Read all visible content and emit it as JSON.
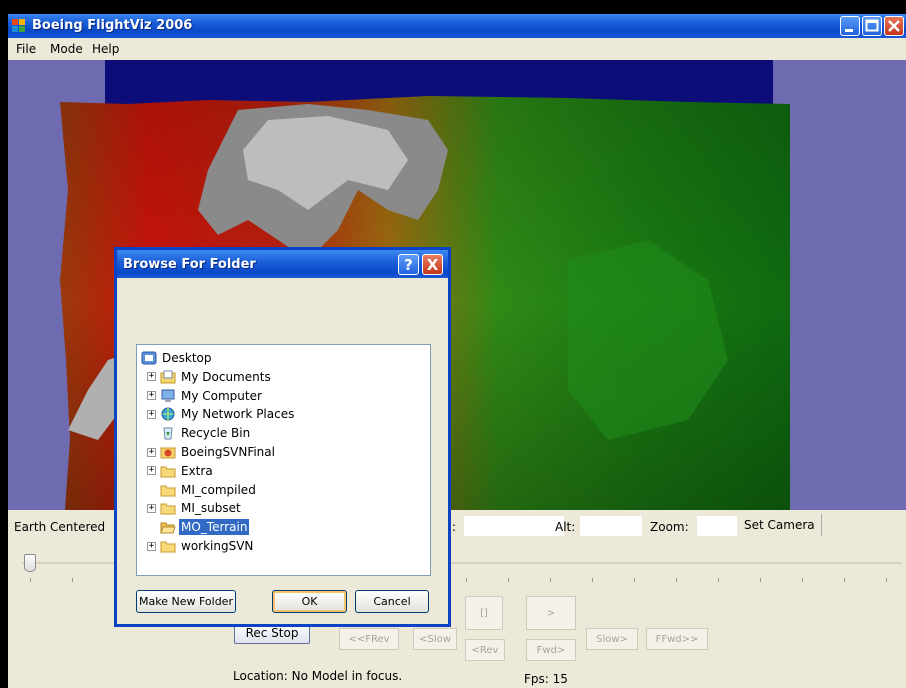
{
  "window": {
    "title": "Boeing FlightViz 2006",
    "icons": {
      "app": "app-icon",
      "minimize": "minimize-icon",
      "maximize": "maximize-icon",
      "close": "close-icon"
    }
  },
  "menu": {
    "items": [
      "File",
      "Mode",
      "Help"
    ]
  },
  "controls": {
    "camera_mode": "Earth Centered",
    "alt_label": "Alt:",
    "zoom_label": "Zoom:",
    "partial_label": ":",
    "set_camera": "Set Camera",
    "alt_value": "",
    "zoom_value": "",
    "rec_stop": "Rec Stop",
    "playback": {
      "stop": "[]",
      "play": ">",
      "ff_rev": "<<FRev",
      "slow_rev": "<Slow",
      "rev": "<Rev",
      "fwd": "Fwd>",
      "slow_fwd": "Slow>",
      "ff_fwd": "FFwd>>"
    },
    "location": "Location: No Model in focus.",
    "fps": "Fps: 15"
  },
  "dialog": {
    "title": "Browse For Folder",
    "help": "?",
    "close": "X",
    "tree": [
      {
        "label": "Desktop",
        "icon": "desktop-icon",
        "expander": false,
        "depth": 0,
        "selected": false
      },
      {
        "label": "My Documents",
        "icon": "my-documents-icon",
        "expander": true,
        "depth": 1,
        "selected": false
      },
      {
        "label": "My Computer",
        "icon": "my-computer-icon",
        "expander": true,
        "depth": 1,
        "selected": false
      },
      {
        "label": "My Network Places",
        "icon": "network-places-icon",
        "expander": true,
        "depth": 1,
        "selected": false
      },
      {
        "label": "Recycle Bin",
        "icon": "recycle-bin-icon",
        "expander": false,
        "depth": 1,
        "selected": false
      },
      {
        "label": "BoeingSVNFinal",
        "icon": "svn-folder-icon",
        "expander": true,
        "depth": 1,
        "selected": false
      },
      {
        "label": "Extra",
        "icon": "folder-icon",
        "expander": true,
        "depth": 1,
        "selected": false
      },
      {
        "label": "MI_compiled",
        "icon": "folder-icon",
        "expander": false,
        "depth": 1,
        "selected": false
      },
      {
        "label": "MI_subset",
        "icon": "folder-icon",
        "expander": true,
        "depth": 1,
        "selected": false
      },
      {
        "label": "MO_Terrain",
        "icon": "open-folder-icon",
        "expander": false,
        "depth": 1,
        "selected": true
      },
      {
        "label": "workingSVN",
        "icon": "folder-icon",
        "expander": true,
        "depth": 1,
        "selected": false
      }
    ],
    "make_new_folder": "Make New Folder",
    "ok": "OK",
    "cancel": "Cancel"
  },
  "colors": {
    "title_blue": "#0b49c8",
    "selection": "#316ac5",
    "face": "#ece9d8",
    "sky": "#6e6bb0",
    "dark_band": "#0d0d7a"
  }
}
